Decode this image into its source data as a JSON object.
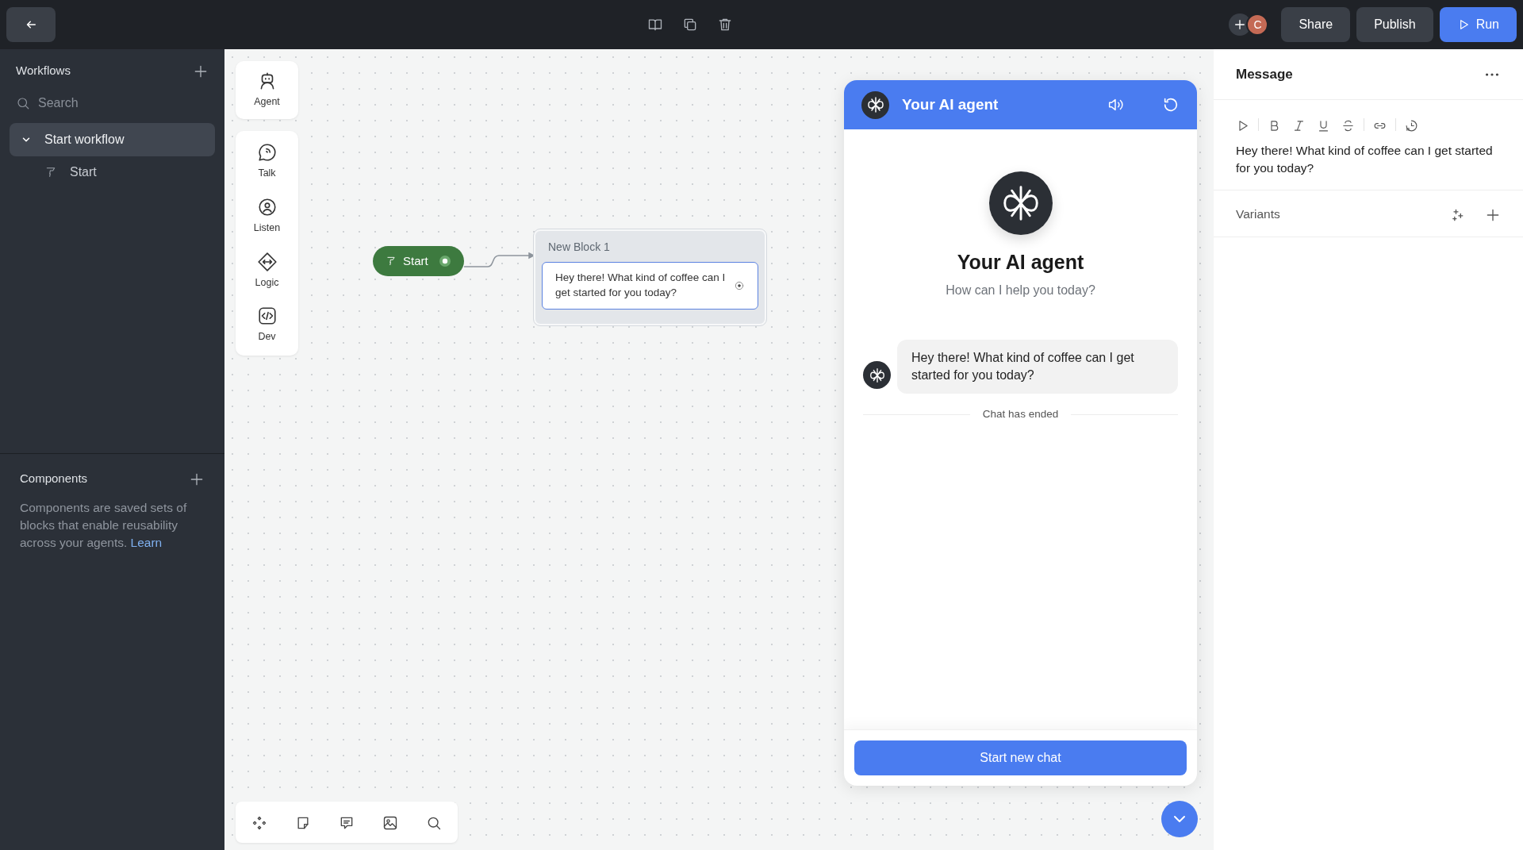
{
  "topbar": {
    "avatar": "C",
    "buttons": [
      {
        "label": "Share",
        "kind": "secondary"
      },
      {
        "label": "Publish",
        "kind": "secondary"
      },
      {
        "label": "Run",
        "kind": "primary"
      }
    ]
  },
  "sidebar": {
    "workflows": {
      "title": "Workflows",
      "search_placeholder": "Search",
      "items": [
        {
          "label": "Start workflow",
          "expanded": true,
          "selected": true,
          "children": [
            {
              "label": "Start",
              "selected": false
            }
          ]
        }
      ]
    },
    "components": {
      "title": "Components",
      "description": "Components are saved sets of blocks that enable reusability across your agents.",
      "link": "Learn"
    }
  },
  "palette": [
    {
      "label": "Agent",
      "kind": "agent"
    },
    {
      "label": "Talk",
      "kind": "talk"
    },
    {
      "label": "Listen",
      "kind": "listen"
    },
    {
      "label": "Logic",
      "kind": "logic"
    },
    {
      "label": "Dev",
      "kind": "dev"
    }
  ],
  "canvas": {
    "start_node": {
      "label": "Start"
    },
    "block": {
      "title": "New Block 1",
      "message": "Hey there! What kind of coffee can I get started for you today?"
    }
  },
  "chat": {
    "title": "Your AI agent",
    "hero_title": "Your AI agent",
    "hero_subtitle": "How can I help you today?",
    "messages": [
      {
        "text": "Hey there! What kind of coffee can I get started for you today?"
      }
    ],
    "status": "Chat has ended",
    "button": "Start new chat"
  },
  "message_panel": {
    "title": "Message",
    "text": "Hey there! What kind of coffee can I get started for you today?",
    "variants_label": "Variants"
  }
}
